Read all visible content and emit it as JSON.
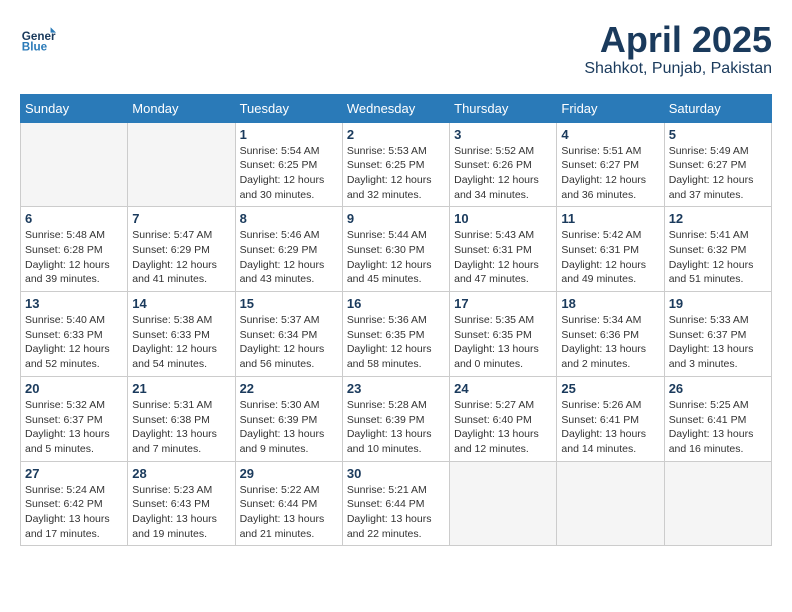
{
  "header": {
    "logo_general": "General",
    "logo_blue": "Blue",
    "month_title": "April 2025",
    "location": "Shahkot, Punjab, Pakistan"
  },
  "weekdays": [
    "Sunday",
    "Monday",
    "Tuesday",
    "Wednesday",
    "Thursday",
    "Friday",
    "Saturday"
  ],
  "weeks": [
    [
      {
        "day": "",
        "info": ""
      },
      {
        "day": "",
        "info": ""
      },
      {
        "day": "1",
        "info": "Sunrise: 5:54 AM\nSunset: 6:25 PM\nDaylight: 12 hours\nand 30 minutes."
      },
      {
        "day": "2",
        "info": "Sunrise: 5:53 AM\nSunset: 6:25 PM\nDaylight: 12 hours\nand 32 minutes."
      },
      {
        "day": "3",
        "info": "Sunrise: 5:52 AM\nSunset: 6:26 PM\nDaylight: 12 hours\nand 34 minutes."
      },
      {
        "day": "4",
        "info": "Sunrise: 5:51 AM\nSunset: 6:27 PM\nDaylight: 12 hours\nand 36 minutes."
      },
      {
        "day": "5",
        "info": "Sunrise: 5:49 AM\nSunset: 6:27 PM\nDaylight: 12 hours\nand 37 minutes."
      }
    ],
    [
      {
        "day": "6",
        "info": "Sunrise: 5:48 AM\nSunset: 6:28 PM\nDaylight: 12 hours\nand 39 minutes."
      },
      {
        "day": "7",
        "info": "Sunrise: 5:47 AM\nSunset: 6:29 PM\nDaylight: 12 hours\nand 41 minutes."
      },
      {
        "day": "8",
        "info": "Sunrise: 5:46 AM\nSunset: 6:29 PM\nDaylight: 12 hours\nand 43 minutes."
      },
      {
        "day": "9",
        "info": "Sunrise: 5:44 AM\nSunset: 6:30 PM\nDaylight: 12 hours\nand 45 minutes."
      },
      {
        "day": "10",
        "info": "Sunrise: 5:43 AM\nSunset: 6:31 PM\nDaylight: 12 hours\nand 47 minutes."
      },
      {
        "day": "11",
        "info": "Sunrise: 5:42 AM\nSunset: 6:31 PM\nDaylight: 12 hours\nand 49 minutes."
      },
      {
        "day": "12",
        "info": "Sunrise: 5:41 AM\nSunset: 6:32 PM\nDaylight: 12 hours\nand 51 minutes."
      }
    ],
    [
      {
        "day": "13",
        "info": "Sunrise: 5:40 AM\nSunset: 6:33 PM\nDaylight: 12 hours\nand 52 minutes."
      },
      {
        "day": "14",
        "info": "Sunrise: 5:38 AM\nSunset: 6:33 PM\nDaylight: 12 hours\nand 54 minutes."
      },
      {
        "day": "15",
        "info": "Sunrise: 5:37 AM\nSunset: 6:34 PM\nDaylight: 12 hours\nand 56 minutes."
      },
      {
        "day": "16",
        "info": "Sunrise: 5:36 AM\nSunset: 6:35 PM\nDaylight: 12 hours\nand 58 minutes."
      },
      {
        "day": "17",
        "info": "Sunrise: 5:35 AM\nSunset: 6:35 PM\nDaylight: 13 hours\nand 0 minutes."
      },
      {
        "day": "18",
        "info": "Sunrise: 5:34 AM\nSunset: 6:36 PM\nDaylight: 13 hours\nand 2 minutes."
      },
      {
        "day": "19",
        "info": "Sunrise: 5:33 AM\nSunset: 6:37 PM\nDaylight: 13 hours\nand 3 minutes."
      }
    ],
    [
      {
        "day": "20",
        "info": "Sunrise: 5:32 AM\nSunset: 6:37 PM\nDaylight: 13 hours\nand 5 minutes."
      },
      {
        "day": "21",
        "info": "Sunrise: 5:31 AM\nSunset: 6:38 PM\nDaylight: 13 hours\nand 7 minutes."
      },
      {
        "day": "22",
        "info": "Sunrise: 5:30 AM\nSunset: 6:39 PM\nDaylight: 13 hours\nand 9 minutes."
      },
      {
        "day": "23",
        "info": "Sunrise: 5:28 AM\nSunset: 6:39 PM\nDaylight: 13 hours\nand 10 minutes."
      },
      {
        "day": "24",
        "info": "Sunrise: 5:27 AM\nSunset: 6:40 PM\nDaylight: 13 hours\nand 12 minutes."
      },
      {
        "day": "25",
        "info": "Sunrise: 5:26 AM\nSunset: 6:41 PM\nDaylight: 13 hours\nand 14 minutes."
      },
      {
        "day": "26",
        "info": "Sunrise: 5:25 AM\nSunset: 6:41 PM\nDaylight: 13 hours\nand 16 minutes."
      }
    ],
    [
      {
        "day": "27",
        "info": "Sunrise: 5:24 AM\nSunset: 6:42 PM\nDaylight: 13 hours\nand 17 minutes."
      },
      {
        "day": "28",
        "info": "Sunrise: 5:23 AM\nSunset: 6:43 PM\nDaylight: 13 hours\nand 19 minutes."
      },
      {
        "day": "29",
        "info": "Sunrise: 5:22 AM\nSunset: 6:44 PM\nDaylight: 13 hours\nand 21 minutes."
      },
      {
        "day": "30",
        "info": "Sunrise: 5:21 AM\nSunset: 6:44 PM\nDaylight: 13 hours\nand 22 minutes."
      },
      {
        "day": "",
        "info": ""
      },
      {
        "day": "",
        "info": ""
      },
      {
        "day": "",
        "info": ""
      }
    ]
  ]
}
